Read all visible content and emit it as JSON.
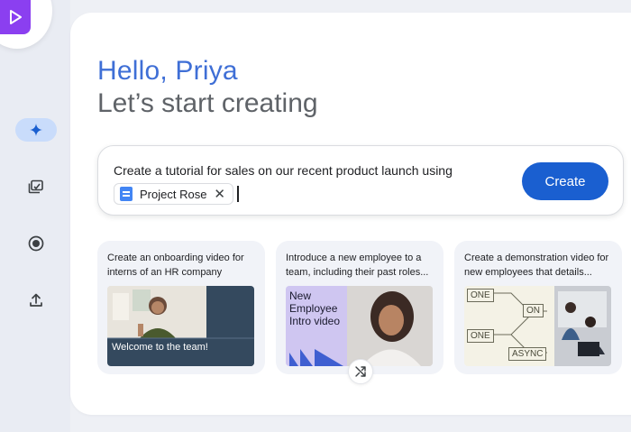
{
  "greeting": {
    "line1": "Hello, Priya",
    "line2": "Let’s start creating"
  },
  "rail": {
    "items": [
      {
        "icon": "sparkle-icon",
        "active": true
      },
      {
        "icon": "video-library-icon",
        "active": false
      },
      {
        "icon": "record-icon",
        "active": false
      },
      {
        "icon": "upload-icon",
        "active": false
      }
    ]
  },
  "prompt": {
    "text": "Create a tutorial for sales on our recent product launch using",
    "chip_label": "Project Rose",
    "create_label": "Create"
  },
  "cards": [
    {
      "text": "Create an onboarding video for interns of an HR company",
      "thumb_caption": "Welcome to the team!"
    },
    {
      "text": "Introduce a new employee to a team, including their past roles...",
      "thumb_caption": "New Employee Intro video"
    },
    {
      "text": "Create a demonstration video for new employees that details...",
      "diagram_labels": [
        "ONE",
        "ON",
        "ONE",
        "ASYNC"
      ]
    }
  ],
  "colors": {
    "accent": "#1a5fd0",
    "greeting_blue": "#3f6fd6",
    "brand_purple": "#8b3ff0"
  }
}
